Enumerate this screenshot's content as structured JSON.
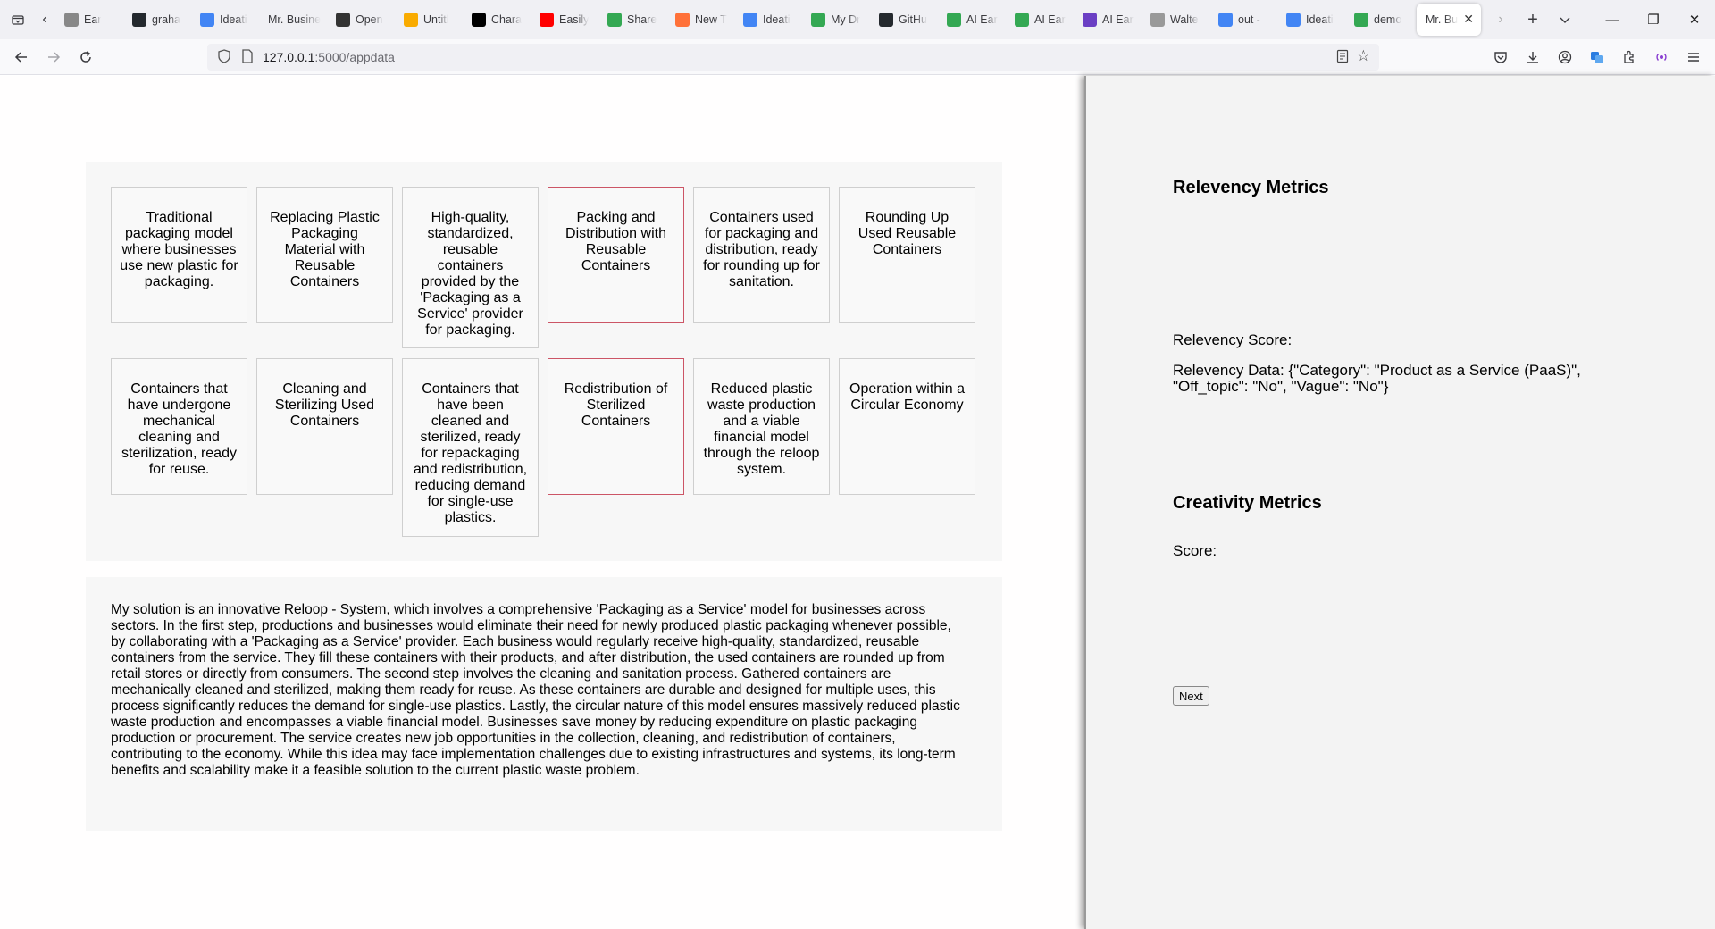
{
  "browser": {
    "tabs": [
      {
        "label": "Ear",
        "icon": "generic-page-icon",
        "color": "#888888"
      },
      {
        "label": "graha",
        "icon": "github-icon",
        "color": "#24292e"
      },
      {
        "label": "Ideati",
        "icon": "docs-icon",
        "color": "#4285f4"
      },
      {
        "label": "Mr. Busine",
        "icon": "",
        "color": ""
      },
      {
        "label": "Open",
        "icon": "openai-icon",
        "color": "#333333"
      },
      {
        "label": "Untitl",
        "icon": "colab-icon",
        "color": "#f9ab00"
      },
      {
        "label": "Chara",
        "icon": "wikipedia-icon",
        "color": "#000000"
      },
      {
        "label": "Easily",
        "icon": "youtube-icon",
        "color": "#ff0000"
      },
      {
        "label": "Share",
        "icon": "drive-icon",
        "color": "#34a853"
      },
      {
        "label": "New T",
        "icon": "firefox-icon",
        "color": "#ff7139"
      },
      {
        "label": "Ideati",
        "icon": "docs-icon",
        "color": "#4285f4"
      },
      {
        "label": "My Dr",
        "icon": "drive-icon",
        "color": "#34a853"
      },
      {
        "label": "GitHu",
        "icon": "github-icon",
        "color": "#24292e"
      },
      {
        "label": "AI Ear",
        "icon": "drive-icon",
        "color": "#34a853"
      },
      {
        "label": "AI Ear",
        "icon": "drive-icon",
        "color": "#34a853"
      },
      {
        "label": "AI Ear",
        "icon": "purple-app-icon",
        "color": "#6b3fc4"
      },
      {
        "label": "Walte",
        "icon": "d-icon",
        "color": "#999999"
      },
      {
        "label": "out -",
        "icon": "google-icon",
        "color": "#4285f4"
      },
      {
        "label": "Ideati",
        "icon": "docs-icon",
        "color": "#4285f4"
      },
      {
        "label": "demo",
        "icon": "drive-icon",
        "color": "#34a853"
      }
    ],
    "active_tab": {
      "label": "Mr. Bu"
    },
    "url_host": "127.0.0.1",
    "url_path": ":5000/appdata"
  },
  "cards": [
    {
      "text": "Traditional packaging model where businesses use new plastic for packaging.",
      "highlight": false
    },
    {
      "text": "Replacing Plastic Packaging Material with Reusable Containers",
      "highlight": false
    },
    {
      "text": "High-quality, standardized, reusable containers provided by the 'Packaging as a Service' provider for packaging.",
      "highlight": false
    },
    {
      "text": "Packing and Distribution with Reusable Containers",
      "highlight": true
    },
    {
      "text": "Containers used for packaging and distribution, ready for rounding up for sanitation.",
      "highlight": false
    },
    {
      "text": "Rounding Up Used Reusable Containers",
      "highlight": false
    },
    {
      "text": "Containers that have undergone mechanical cleaning and sterilization, ready for reuse.",
      "highlight": false
    },
    {
      "text": "Cleaning and Sterilizing Used Containers",
      "highlight": false
    },
    {
      "text": "Containers that have been cleaned and sterilized, ready for repackaging and redistribution, reducing demand for single-use plastics.",
      "highlight": false
    },
    {
      "text": "Redistribution of Sterilized Containers",
      "highlight": true
    },
    {
      "text": "Reduced plastic waste production and a viable financial model through the reloop system.",
      "highlight": false
    },
    {
      "text": "Operation within a Circular Economy",
      "highlight": false
    }
  ],
  "description": "My solution is an innovative Reloop - System, which involves a comprehensive 'Packaging as a Service' model for businesses across sectors. In the first step, productions and businesses would eliminate their need for newly produced plastic packaging whenever possible, by collaborating with a 'Packaging as a Service' provider. Each business would regularly receive high-quality, standardized, reusable containers from the service. They fill these containers with their products, and after distribution, the used containers are rounded up from retail stores or directly from consumers. The second step involves the cleaning and sanitation process. Gathered containers are mechanically cleaned and sterilized, making them ready for reuse. As these containers are durable and designed for multiple uses, this process significantly reduces the demand for single-use plastics. Lastly, the circular nature of this model ensures massively reduced plastic waste production and encompasses a viable financial model. Businesses save money by reducing expenditure on plastic packaging production or procurement. The service creates new job opportunities in the collection, cleaning, and redistribution of containers, contributing to the economy. While this idea may face implementation challenges due to existing infrastructures and systems, its long-term benefits and scalability make it a feasible solution to the current plastic waste problem.",
  "metrics": {
    "relevency_title": "Relevency Metrics",
    "relevency_score_label": "Relevency Score:",
    "relevency_data": "Relevency Data: {\"Category\": \"Product as a Service (PaaS)\", \"Off_topic\": \"No\", \"Vague\": \"No\"}",
    "creativity_title": "Creativity Metrics",
    "creativity_score_label": "Score:",
    "next_label": "Next"
  }
}
